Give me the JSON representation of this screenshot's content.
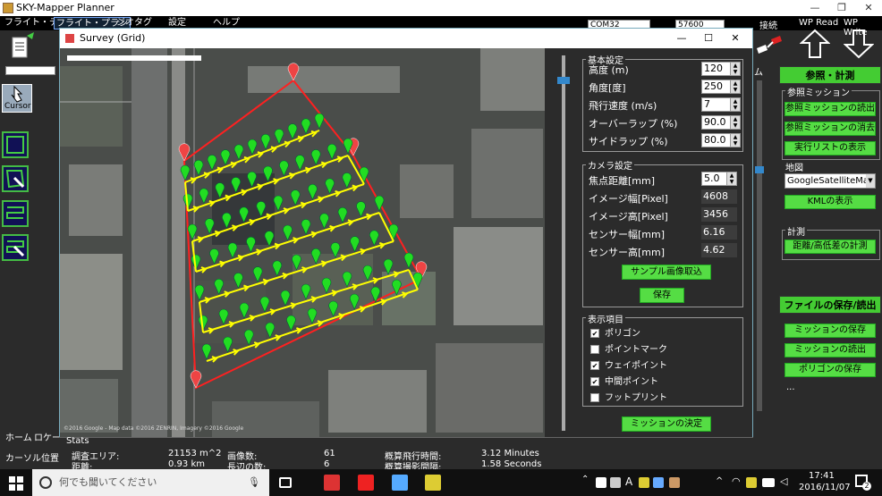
{
  "app": {
    "title": "SKY-Mapper Planner",
    "menu": [
      "フライト・データ",
      "フライト・プラン",
      "ジオタグ",
      "設定",
      "ヘルプ"
    ],
    "com_port": "COM32",
    "baud": "57600",
    "connect_label": "接続",
    "wp_read_label": "WP Read",
    "wp_write_label": "WP Write",
    "cursor_label": "Cursor"
  },
  "left_lower": {
    "home_label": "ホーム",
    "location_label": "ロケーシ",
    "cursor_pos_label": "カーソル位置"
  },
  "right_panel": {
    "tab_partial": "ム",
    "ref_header": "参照・計測",
    "ref_mission_group": "参照ミッション",
    "btn_read_ref": "参照ミッションの読出",
    "btn_clear_ref": "参照ミッションの消去",
    "btn_show_exec": "実行リストの表示",
    "map_label": "地図",
    "map_select": "GoogleSatelliteMa",
    "btn_kml": "KMLの表示",
    "measure_group": "計測",
    "btn_measure": "距離/高低差の計測",
    "file_header": "ファイルの保存/読出",
    "btn_save_mission": "ミッションの保存",
    "btn_load_mission": "ミッションの読出",
    "btn_save_polygon": "ポリゴンの保存",
    "more": "..."
  },
  "dialog": {
    "title": "Survey (Grid)",
    "basic_group": "基本設定",
    "fields": [
      {
        "label": "高度 (m)",
        "value": "120"
      },
      {
        "label": "角度[度]",
        "value": "250"
      },
      {
        "label": "飛行速度 (m/s)",
        "value": "7"
      },
      {
        "label": "オーバーラップ (%)",
        "value": "90.0"
      },
      {
        "label": "サイドラップ (%)",
        "value": "80.0"
      }
    ],
    "camera_group": "カメラ設定",
    "camera": [
      {
        "label": "焦点距離[mm]",
        "value": "5.0"
      },
      {
        "label": "イメージ幅[Pixel]",
        "value": "4608"
      },
      {
        "label": "イメージ高[Pixel]",
        "value": "3456"
      },
      {
        "label": "センサー幅[mm]",
        "value": "6.16"
      },
      {
        "label": "センサー高[mm]",
        "value": "4.62"
      }
    ],
    "btn_sample": "サンプル画像取込",
    "btn_save": "保存",
    "display_group": "表示項目",
    "display_items": [
      {
        "label": "ポリゴン",
        "checked": "✔"
      },
      {
        "label": "ポイントマーク",
        "checked": ""
      },
      {
        "label": "ウェイポイント",
        "checked": "✔"
      },
      {
        "label": "中間ポイント",
        "checked": "✔"
      },
      {
        "label": "フットプリント",
        "checked": ""
      }
    ],
    "btn_decide": "ミッションの決定",
    "map_attribution": "©2016 Google - Map data ©2016 ZENRIN, Imagery ©2016 Google"
  },
  "stats": {
    "title": "Stats",
    "rows": [
      {
        "k1": "調査エリア:",
        "v1": "21153 m^2",
        "k2": "画像数:",
        "v2": "61",
        "k3": "概算飛行時間:",
        "v3": "3.12 Minutes"
      },
      {
        "k1": "距離:",
        "v1": "0.93 km",
        "k2": "長辺の数:",
        "v2": "6",
        "k3": "概算撮影間隔:",
        "v3": "1.58 Seconds"
      }
    ]
  },
  "taskbar": {
    "search_placeholder": "何でも聞いてください",
    "time": "17:41",
    "date": "2016/11/07",
    "ime": "A",
    "notif_count": "2"
  },
  "colors": {
    "accent_green": "#55dd44",
    "path_yellow": "#ffff00",
    "polygon_red": "#ff2020",
    "marker_green": "#22dd22"
  }
}
